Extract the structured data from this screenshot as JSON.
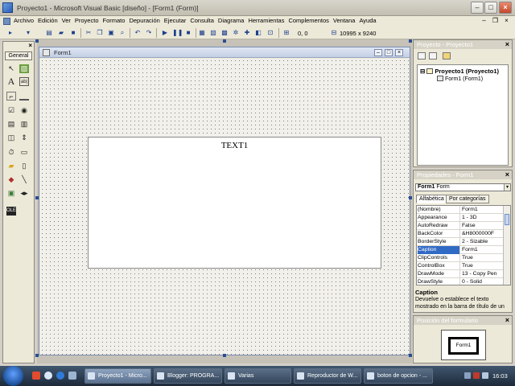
{
  "window": {
    "title": "Proyecto1 - Microsoft Visual Basic [diseño] - [Form1 (Form)]"
  },
  "menu": [
    "Archivo",
    "Edición",
    "Ver",
    "Proyecto",
    "Formato",
    "Depuración",
    "Ejecutar",
    "Consulta",
    "Diagrama",
    "Herramientas",
    "Complementos",
    "Ventana",
    "Ayuda"
  ],
  "toolbar": {
    "position": "0, 0",
    "size": "10995 x 9240"
  },
  "toolbox": {
    "tab_label": "General"
  },
  "designer": {
    "title": "Form1",
    "textbox_text": "TEXT1"
  },
  "project_panel": {
    "title": "Proyecto - Proyecto1",
    "tree": [
      {
        "label": "Proyecto1 (Proyecto1)"
      },
      {
        "label": "Form1 (Form1)"
      }
    ]
  },
  "properties_panel": {
    "title": "Propiedades - Form1",
    "object_name": "Form1",
    "object_type": "Form",
    "tabs": [
      "Alfabética",
      "Por categorías"
    ],
    "rows": [
      {
        "name": "(Nombre)",
        "value": "Form1"
      },
      {
        "name": "Appearance",
        "value": "1 - 3D"
      },
      {
        "name": "AutoRedraw",
        "value": "False"
      },
      {
        "name": "BackColor",
        "value": "&H8000000F"
      },
      {
        "name": "BorderStyle",
        "value": "2 - Sizable"
      },
      {
        "name": "Caption",
        "value": "Form1"
      },
      {
        "name": "ClipControls",
        "value": "True"
      },
      {
        "name": "ControlBox",
        "value": "True"
      },
      {
        "name": "DrawMode",
        "value": "13 - Copy Pen"
      },
      {
        "name": "DrawStyle",
        "value": "0 - Solid"
      }
    ],
    "selected_row": 5,
    "description_title": "Caption",
    "description_text": "Devuelve o establece el texto mostrado en la barra de título de un"
  },
  "form_position_panel": {
    "title": "Posición del formulario",
    "mini_label": "Form1"
  },
  "taskbar": {
    "tasks": [
      {
        "label": "Proyecto1 - Micro..."
      },
      {
        "label": "Blogger: PROGRA..."
      },
      {
        "label": "Varias"
      },
      {
        "label": "Reproductor de W..."
      },
      {
        "label": "boton de opcion - ..."
      }
    ],
    "clock": "16:03"
  },
  "colors": {
    "selection": "#316ac5",
    "handle": "#2a4e92",
    "taskbar": "#1d2a3a"
  }
}
